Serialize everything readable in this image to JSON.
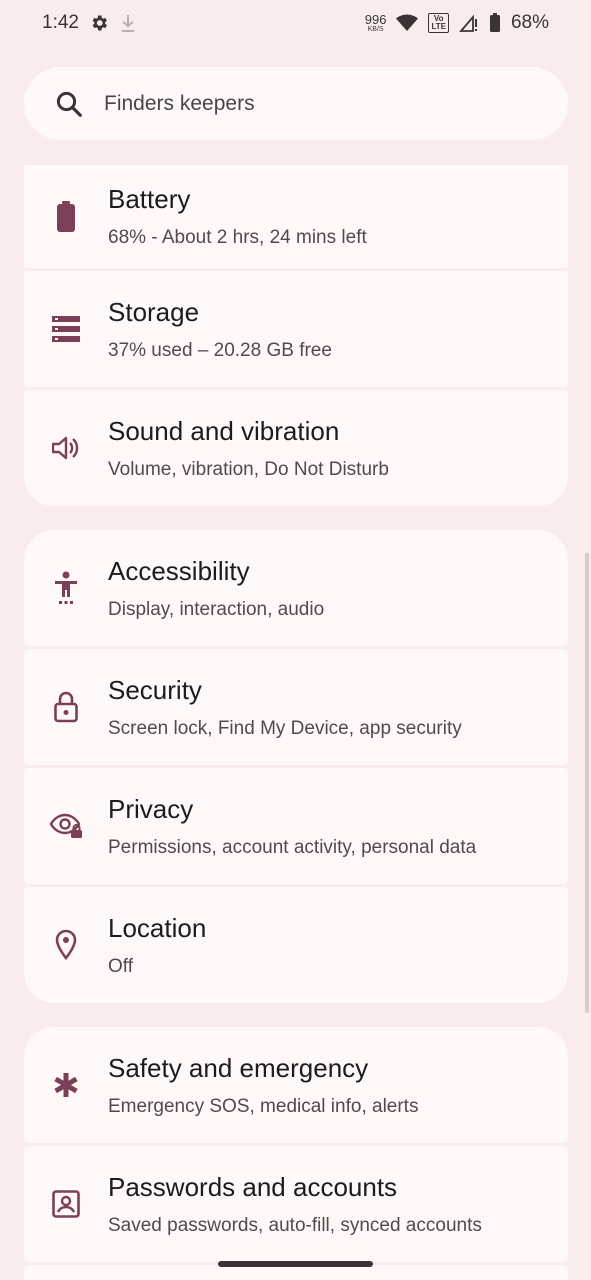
{
  "status": {
    "time": "1:42",
    "net_speed_value": "996",
    "net_speed_unit": "KB/S",
    "volte_top": "Vo",
    "volte_bottom": "LTE",
    "battery": "68%"
  },
  "search": {
    "text": "Finders keepers",
    "icon": "search-icon"
  },
  "items": [
    {
      "icon": "battery-icon",
      "title": "Battery",
      "subtitle": "68% - About 2 hrs, 24 mins left"
    },
    {
      "icon": "storage-icon",
      "title": "Storage",
      "subtitle": "37% used – 20.28 GB free"
    },
    {
      "icon": "volume-icon",
      "title": "Sound and vibration",
      "subtitle": "Volume, vibration, Do Not Disturb"
    },
    {
      "icon": "accessibility-icon",
      "title": "Accessibility",
      "subtitle": "Display, interaction, audio"
    },
    {
      "icon": "lock-icon",
      "title": "Security",
      "subtitle": "Screen lock, Find My Device, app security"
    },
    {
      "icon": "privacy-eye-icon",
      "title": "Privacy",
      "subtitle": "Permissions, account activity, personal data"
    },
    {
      "icon": "location-pin-icon",
      "title": "Location",
      "subtitle": "Off"
    },
    {
      "icon": "asterisk-icon",
      "title": "Safety and emergency",
      "subtitle": "Emergency SOS, medical info, alerts"
    },
    {
      "icon": "account-box-icon",
      "title": "Passwords and accounts",
      "subtitle": "Saved passwords, auto-fill, synced accounts"
    }
  ],
  "colors": {
    "background": "#f8ecec",
    "card": "#fff8f8",
    "icon_accent": "#7b3f57"
  }
}
